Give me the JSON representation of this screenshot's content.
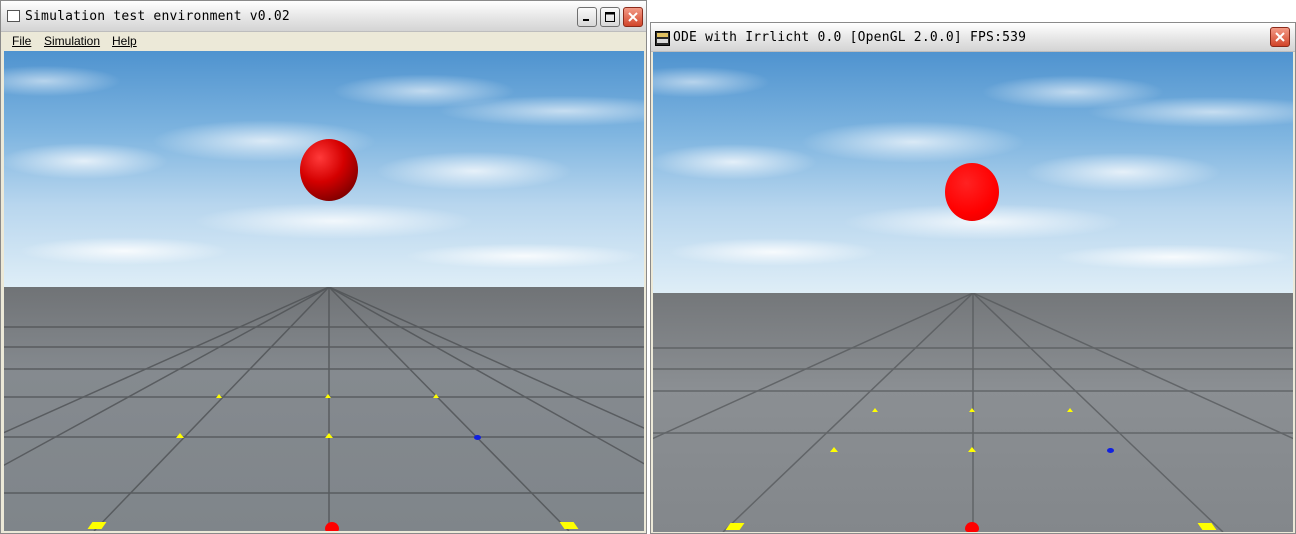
{
  "left_window": {
    "title": "Simulation test environment v0.02",
    "menu": [
      {
        "label": "File"
      },
      {
        "label": "Simulation"
      },
      {
        "label": "Help"
      }
    ]
  },
  "right_window": {
    "title": "ODE with Irrlicht 0.0 [OpenGL 2.0.0] FPS:539"
  },
  "icons": {
    "left_app_icon": "window-icon",
    "right_app_icon": "irrlicht-logo-icon",
    "minimize": "minimize-icon",
    "maximize": "maximize-icon",
    "close": "close-icon"
  },
  "colors": {
    "ball_left": "#cc0000",
    "ball_right": "#ff1010",
    "marker_yellow": "#ffff00",
    "marker_blue": "#1020e0",
    "marker_red": "#ff0000",
    "ground": "#7a7d80",
    "sky": "#7fb5e0"
  }
}
